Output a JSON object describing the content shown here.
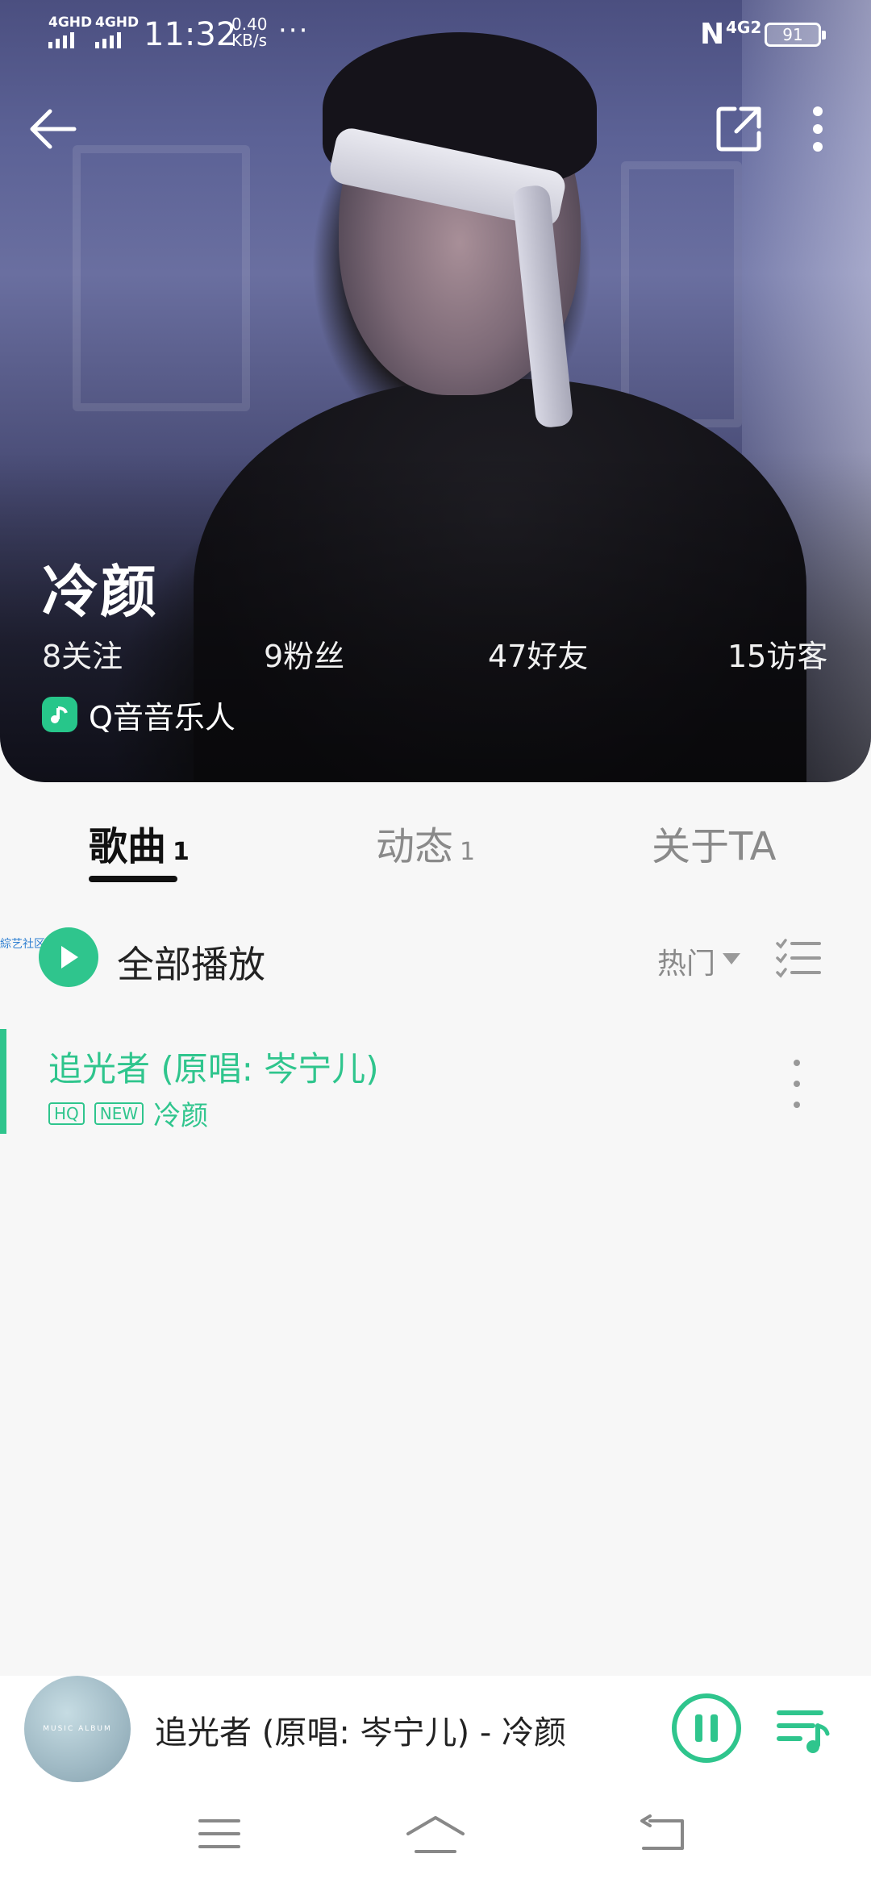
{
  "status_bar": {
    "signal_1": "4GHD",
    "signal_2": "4GHD",
    "time": "11:32",
    "speed_value": "0.40",
    "speed_unit": "KB/s",
    "more": "···",
    "nfc": "N",
    "network": "4G2",
    "battery": "91"
  },
  "header": {
    "back_icon": "arrow-left-icon",
    "share_icon": "share-external-icon",
    "more_icon": "vertical-dots-icon"
  },
  "profile": {
    "name": "冷颜",
    "stats": {
      "follow": "8关注",
      "fans": "9粉丝",
      "friends": "47好友",
      "visitors": "15访客"
    },
    "badge_label": "Q音音乐人",
    "badge_icon": "music-note-icon"
  },
  "tabs": [
    {
      "label": "歌曲",
      "count": "1"
    },
    {
      "label": "动态",
      "count": "1"
    },
    {
      "label": "关于TA",
      "count": ""
    }
  ],
  "song_list": {
    "tiny_tag": "綜艺社区",
    "play_all": "全部播放",
    "sort": "热门",
    "songs": [
      {
        "title": "追光者 (原唱: 岑宁儿)",
        "tags": [
          "HQ",
          "NEW"
        ],
        "artist": "冷颜"
      }
    ]
  },
  "player": {
    "album_text": "MUSIC ALBUM",
    "now_playing": "追光者 (原唱: 岑宁儿) - 冷颜",
    "pause_icon": "pause-icon",
    "queue_icon": "playlist-queue-icon"
  },
  "nav": {
    "menu_icon": "menu-icon",
    "home_icon": "home-icon",
    "back_icon": "back-icon"
  },
  "colors": {
    "accent": "#2fc58d",
    "text_dark": "#222222",
    "text_muted": "#8a8a8a"
  }
}
